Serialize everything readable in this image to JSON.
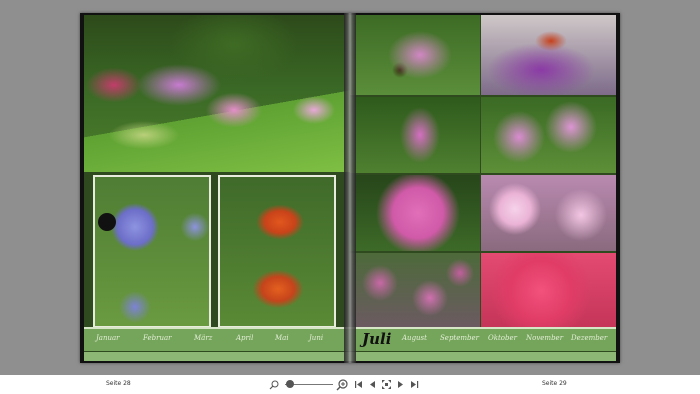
{
  "left_page": {
    "months": [
      "Januar",
      "Februar",
      "März",
      "April",
      "Mai",
      "Juni"
    ],
    "photos": [
      "garden-border-photo",
      "globe-thistle-photo",
      "orange-lily-photo"
    ]
  },
  "right_page": {
    "current_month": "Juli",
    "months": [
      "August",
      "September",
      "Oktober",
      "November",
      "Dezember"
    ],
    "photos": [
      "pink-flowers-with-bee-photo",
      "butterfly-on-buddleia-photo",
      "bee-on-pink-flowers-photo",
      "pink-mallow-photo",
      "pink-hydrangea-photo",
      "phlox-photo",
      "echinacea-photo",
      "red-hydrangea-photo"
    ]
  },
  "toolbar": {
    "left_page_label": "Seite 28",
    "right_page_label": "Seite 29",
    "zoom_level": 0.1
  }
}
